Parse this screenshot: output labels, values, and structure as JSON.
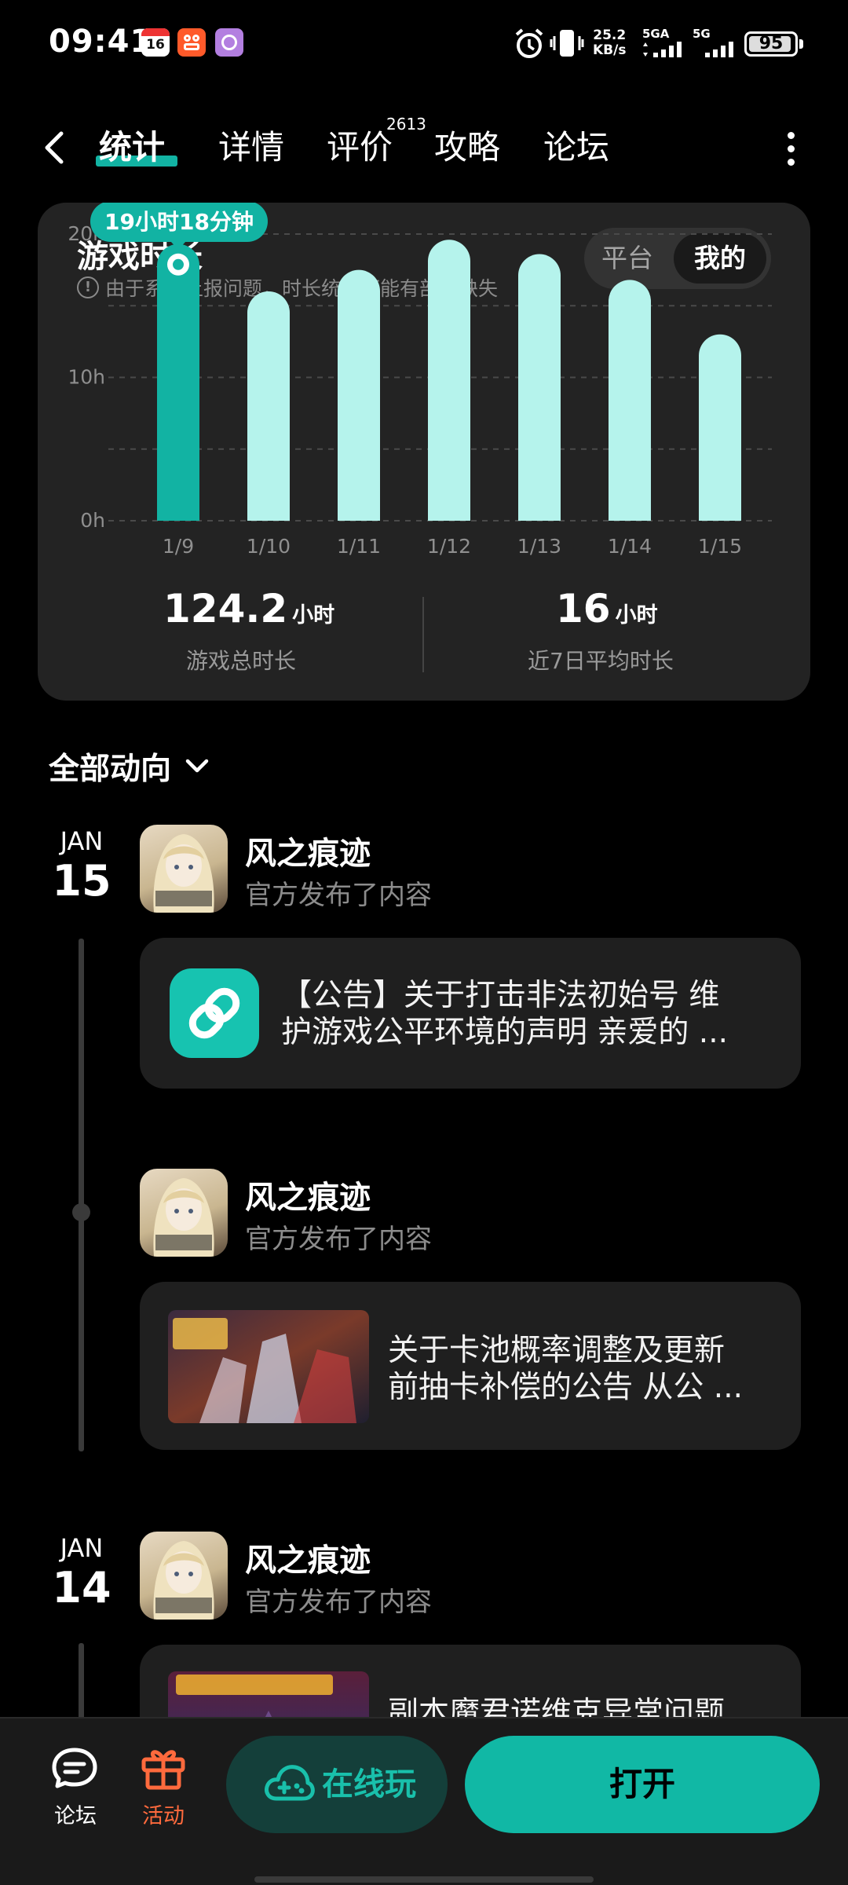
{
  "status_bar": {
    "time": "09:41",
    "net_speed_value": "25.2",
    "net_speed_unit": "KB/s",
    "signal1_label": "5GA",
    "signal2_label": "5G",
    "battery": "95",
    "calendar_day": "16"
  },
  "tabs": {
    "stats": "统计",
    "details": "详情",
    "reviews": "评价",
    "review_count": "2613",
    "guides": "攻略",
    "forum": "论坛"
  },
  "stats_card": {
    "title": "游戏时长",
    "note": "由于系统上报问题，时长统计可能有部分缺失",
    "toggle_platform": "平台",
    "toggle_mine": "我的",
    "total_value": "124.2",
    "total_unit": "小时",
    "total_label": "游戏总时长",
    "avg_value": "16",
    "avg_unit": "小时",
    "avg_label": "近7日平均时长"
  },
  "chart_data": {
    "type": "bar",
    "categories": [
      "1/9",
      "1/10",
      "1/11",
      "1/12",
      "1/13",
      "1/14",
      "1/15"
    ],
    "values": [
      19.3,
      16.0,
      17.5,
      19.6,
      18.6,
      16.8,
      13.0
    ],
    "y_ticks": [
      "0h",
      "10h",
      "20h"
    ],
    "ylim": [
      0,
      20
    ],
    "highlight_index": 0,
    "tooltip": "19小时18分钟",
    "colors": {
      "highlight": "#12b3a3",
      "bar": "#b5f3ec"
    },
    "grid": true
  },
  "feed": {
    "filter_label": "全部动向",
    "groups": [
      {
        "month": "JAN",
        "day": "15"
      },
      {
        "month": "JAN",
        "day": "14"
      }
    ],
    "posts": [
      {
        "name": "风之痕迹",
        "sub": "官方发布了内容",
        "text_line1": "【公告】关于打击非法初始号 维",
        "text_line2": "护游戏公平环境的声明 亲爱的 ..."
      },
      {
        "name": "风之痕迹",
        "sub": "官方发布了内容",
        "text_line1": "关于卡池概率调整及更新",
        "text_line2": "前抽卡补偿的公告 从公 ..."
      },
      {
        "name": "风之痕迹",
        "sub": "官方发布了内容",
        "text_line1": "副本魔君诺维克异常问题",
        "text_line2": ""
      }
    ]
  },
  "bottom_bar": {
    "forum_label": "论坛",
    "events_label": "活动",
    "online_label": "在线玩",
    "open_label": "打开",
    "events_color": "#ff6a3d",
    "accent_color": "#11b8a5"
  }
}
